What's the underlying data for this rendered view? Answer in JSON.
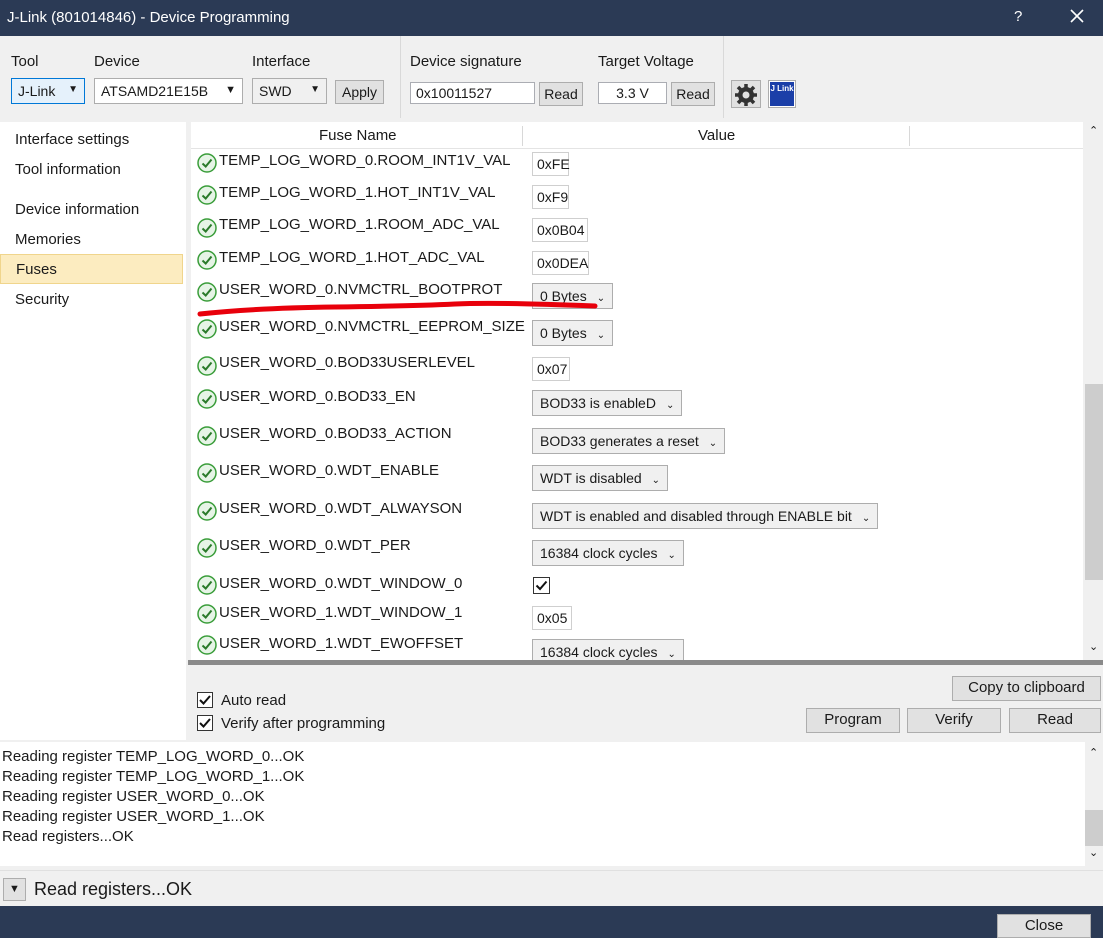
{
  "window": {
    "title": "J-Link (801014846) - Device Programming",
    "help": "?"
  },
  "toolbar": {
    "tool_label": "Tool",
    "tool_value": "J-Link",
    "device_label": "Device",
    "device_value": "ATSAMD21E15B",
    "interface_label": "Interface",
    "interface_value": "SWD",
    "apply_label": "Apply",
    "signature_label": "Device signature",
    "signature_value": "0x10011527",
    "signature_read": "Read",
    "voltage_label": "Target Voltage",
    "voltage_value": "3.3 V",
    "voltage_read": "Read",
    "settings_icon": "gear-icon",
    "jlink_icon": "jlink-logo-icon",
    "jlink_logo_text": "J Link"
  },
  "sidebar": {
    "items": [
      {
        "label": "Interface settings",
        "selected": false
      },
      {
        "label": "Tool information",
        "selected": false
      },
      {
        "label": "Device information",
        "selected": false
      },
      {
        "label": "Memories",
        "selected": false
      },
      {
        "label": "Fuses",
        "selected": true
      },
      {
        "label": "Security",
        "selected": false
      }
    ]
  },
  "fuses": {
    "col_name": "Fuse Name",
    "col_value": "Value",
    "rows": [
      {
        "name": "TEMP_LOG_WORD_0.ROOM_INT1V_VAL",
        "type": "text",
        "value": "0xFE"
      },
      {
        "name": "TEMP_LOG_WORD_1.HOT_INT1V_VAL",
        "type": "text",
        "value": "0xF9"
      },
      {
        "name": "TEMP_LOG_WORD_1.ROOM_ADC_VAL",
        "type": "text",
        "value": "0x0B04"
      },
      {
        "name": "TEMP_LOG_WORD_1.HOT_ADC_VAL",
        "type": "text",
        "value": "0x0DEA"
      },
      {
        "name": "USER_WORD_0.NVMCTRL_BOOTPROT",
        "type": "select",
        "value": "0 Bytes"
      },
      {
        "name": "USER_WORD_0.NVMCTRL_EEPROM_SIZE",
        "type": "select",
        "value": "0 Bytes"
      },
      {
        "name": "USER_WORD_0.BOD33USERLEVEL",
        "type": "text",
        "value": "0x07"
      },
      {
        "name": "USER_WORD_0.BOD33_EN",
        "type": "select",
        "value": "BOD33 is enableD"
      },
      {
        "name": "USER_WORD_0.BOD33_ACTION",
        "type": "select",
        "value": "BOD33 generates a reset"
      },
      {
        "name": "USER_WORD_0.WDT_ENABLE",
        "type": "select",
        "value": "WDT is disabled"
      },
      {
        "name": "USER_WORD_0.WDT_ALWAYSON",
        "type": "select",
        "value": "WDT is enabled and disabled through ENABLE bit"
      },
      {
        "name": "USER_WORD_0.WDT_PER",
        "type": "select",
        "value": "16384 clock cycles"
      },
      {
        "name": "USER_WORD_0.WDT_WINDOW_0",
        "type": "checkbox",
        "value": "checked"
      },
      {
        "name": "USER_WORD_1.WDT_WINDOW_1",
        "type": "text",
        "value": "0x05"
      },
      {
        "name": "USER_WORD_1.WDT_EWOFFSET",
        "type": "select",
        "value": "16384 clock cycles"
      }
    ]
  },
  "options": {
    "auto_read": "Auto read",
    "verify_after": "Verify after programming",
    "copy_clipboard": "Copy to clipboard",
    "program": "Program",
    "verify": "Verify",
    "read": "Read"
  },
  "log": {
    "lines": [
      "Reading register TEMP_LOG_WORD_0...OK",
      "Reading register TEMP_LOG_WORD_1...OK",
      "Reading register USER_WORD_0...OK",
      "Reading register USER_WORD_1...OK",
      "Read registers...OK"
    ]
  },
  "status": {
    "text": "Read registers...OK"
  },
  "footer": {
    "close": "Close"
  },
  "colors": {
    "titlebar": "#2b3a55",
    "selected_item": "#fcecc0",
    "annotation_stroke": "#e8000b",
    "check_green": "#3a9d3a"
  }
}
